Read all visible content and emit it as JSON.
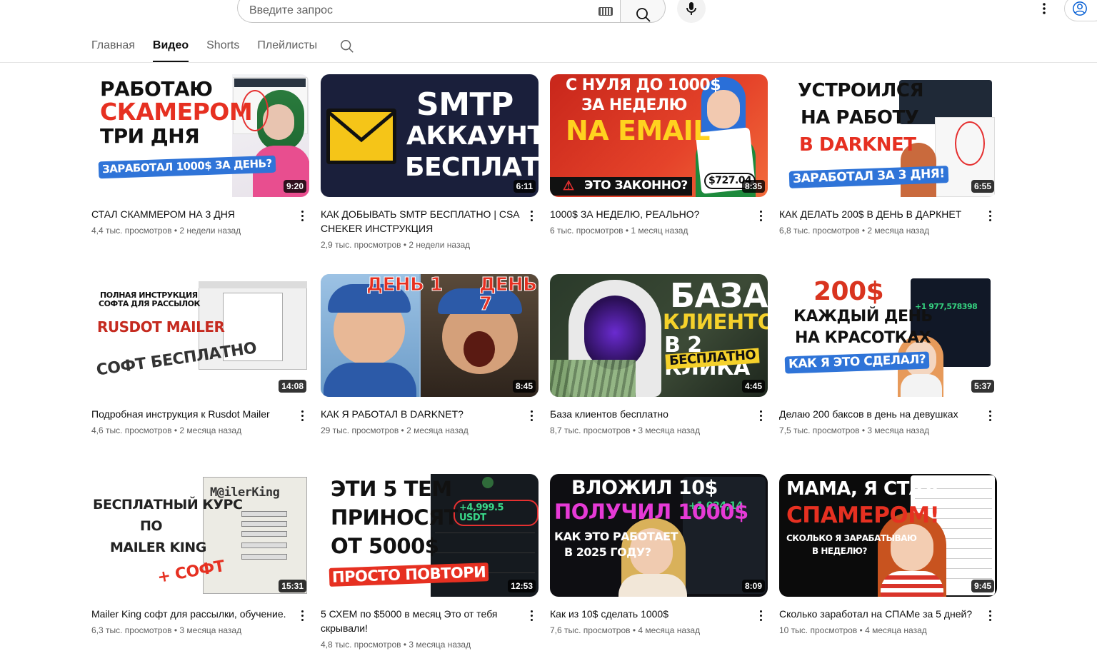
{
  "search": {
    "placeholder": "Введите запрос"
  },
  "tabs": [
    {
      "label": "Главная",
      "active": false
    },
    {
      "label": "Видео",
      "active": true
    },
    {
      "label": "Shorts",
      "active": false
    },
    {
      "label": "Плейлисты",
      "active": false
    }
  ],
  "videos": [
    {
      "title": "СТАЛ СКАММЕРОМ НА 3 ДНЯ",
      "views": "4,4 тыс. просмотров",
      "age": "2 недели назад",
      "duration": "9:20",
      "thumb": [
        "РАБОТАЮ",
        "СКАМЕРОМ",
        "ТРИ ДНЯ",
        "ЗАРАБОТАЛ 1000$ ЗА ДЕНЬ?"
      ]
    },
    {
      "title": "КАК ДОБЫВАТЬ SMTP БЕСПЛАТНО | CSA CHEKER ИНСТРУКЦИЯ",
      "views": "2,9 тыс. просмотров",
      "age": "2 недели назад",
      "duration": "6:11",
      "thumb": [
        "SMTP",
        "АККАУНТЫ",
        "БЕСПЛАТНО"
      ]
    },
    {
      "title": "1000$ ЗА НЕДЕЛЮ, РЕАЛЬНО?",
      "views": "6 тыс. просмотров",
      "age": "1 месяц назад",
      "duration": "8:35",
      "thumb": [
        "С НУЛЯ ДО 1000$",
        "ЗА НЕДЕЛЮ",
        "NA EMAIL",
        "ЭТО ЗАКОННО?",
        "$727.04"
      ]
    },
    {
      "title": "КАК ДЕЛАТЬ 200$ В ДЕНЬ В ДАРКНЕТ",
      "views": "6,8 тыс. просмотров",
      "age": "2 месяца назад",
      "duration": "6:55",
      "thumb": [
        "УСТРОИЛСЯ",
        "НА РАБОТУ",
        "В DARKNET",
        "ЗАРАБОТАЛ ЗА 3 ДНЯ!"
      ]
    },
    {
      "title": "Подробная инструкция к Rusdot Mailer",
      "views": "4,6 тыс. просмотров",
      "age": "2 месяца назад",
      "duration": "14:08",
      "thumb": [
        "ПОЛНАЯ ИНСТРУКЦИЯ",
        "СОФТА ДЛЯ РАССЫЛОК",
        "RUSDOT MAILER",
        "СОФТ БЕСПЛАТНО"
      ]
    },
    {
      "title": "КАК Я РАБОТАЛ В DARKNET?",
      "views": "29 тыс. просмотров",
      "age": "2 месяца назад",
      "duration": "8:45",
      "thumb": [
        "ДЕНЬ 1",
        "ДЕНЬ 7"
      ]
    },
    {
      "title": "База клиентов бесплатно",
      "views": "8,7 тыс. просмотров",
      "age": "3 месяца назад",
      "duration": "4:45",
      "thumb": [
        "БАЗА",
        "КЛИЕНТОВ",
        "В 2 КЛИКА",
        "БЕСПЛАТНО"
      ]
    },
    {
      "title": "Делаю 200 баксов в день на девушках",
      "views": "7,5 тыс. просмотров",
      "age": "3 месяца назад",
      "duration": "5:37",
      "thumb": [
        "200$",
        "КАЖДЫЙ ДЕНЬ",
        "НА КРАСОТКАХ",
        "КАК Я ЭТО СДЕЛАЛ?",
        "+1 977,578398"
      ]
    },
    {
      "title": "Mailer King софт для рассылки, обучение.",
      "views": "6,3 тыс. просмотров",
      "age": "3 месяца назад",
      "duration": "15:31",
      "thumb": [
        "БЕСПЛАТНЫЙ КУРС",
        "ПО",
        "MAILER KING",
        "+ СОФТ",
        "M@ilerKing"
      ]
    },
    {
      "title": "5 СХЕМ по $5000 в месяц Это от тебя скрывали!",
      "views": "4,8 тыс. просмотров",
      "age": "3 месяца назад",
      "duration": "12:53",
      "thumb": [
        "ЭТИ 5 ТЕМ",
        "ПРИНОСЯТ",
        "ОТ 5000$",
        "ПРОСТО ПОВТОРИ",
        "+4,999.5 USDT"
      ]
    },
    {
      "title": "Как из 10$ сделать 1000$",
      "views": "7,6 тыс. просмотров",
      "age": "4 месяца назад",
      "duration": "8:09",
      "thumb": [
        "ВЛОЖИЛ 10$",
        "ПОЛУЧИЛ 1000$",
        "КАК ЭТО РАБОТАЕТ",
        "В 2025 ГОДУ?",
        "+1 024,14"
      ]
    },
    {
      "title": "Сколько заработал на СПАМе за 5 дней?",
      "views": "10 тыс. просмотров",
      "age": "4 месяца назад",
      "duration": "9:45",
      "thumb": [
        "МАМА, Я СТАЛ",
        "СПАМЕРОМ!",
        "СКОЛЬКО Я ЗАРАБАТЫВАЮ",
        "В НЕДЕЛЮ?"
      ]
    }
  ],
  "dot_separator": "•",
  "colors": {
    "accent": "#0f0f0f",
    "muted": "#606060",
    "divider": "#e5e5e5"
  }
}
